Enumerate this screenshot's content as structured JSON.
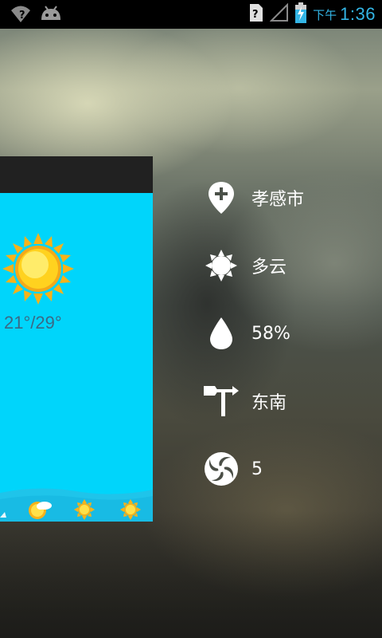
{
  "status_bar": {
    "ampm": "下午",
    "time": "1:36",
    "icons": [
      "wifi-unknown-icon",
      "android-debug-icon",
      "sim-unknown-icon",
      "signal-icon",
      "battery-charging-icon"
    ],
    "accent_color": "#33b5e5"
  },
  "widget": {
    "header_color": "#212121",
    "body_color": "#00d5fb",
    "temperature_range": "21°/29°",
    "main_icon": "sun-icon",
    "forecast_icons": [
      "partly-cloudy-sun-icon",
      "sun-icon",
      "sun-icon"
    ]
  },
  "details": {
    "city": {
      "icon": "location-pin-icon",
      "label": "孝感市"
    },
    "condition": {
      "icon": "weather-sun-icon",
      "label": "多云"
    },
    "humidity": {
      "icon": "water-drop-icon",
      "label": "58%"
    },
    "wind_direction": {
      "icon": "wind-vane-icon",
      "label": "东南"
    },
    "wind_level": {
      "icon": "swirl-icon",
      "label": "5"
    }
  }
}
